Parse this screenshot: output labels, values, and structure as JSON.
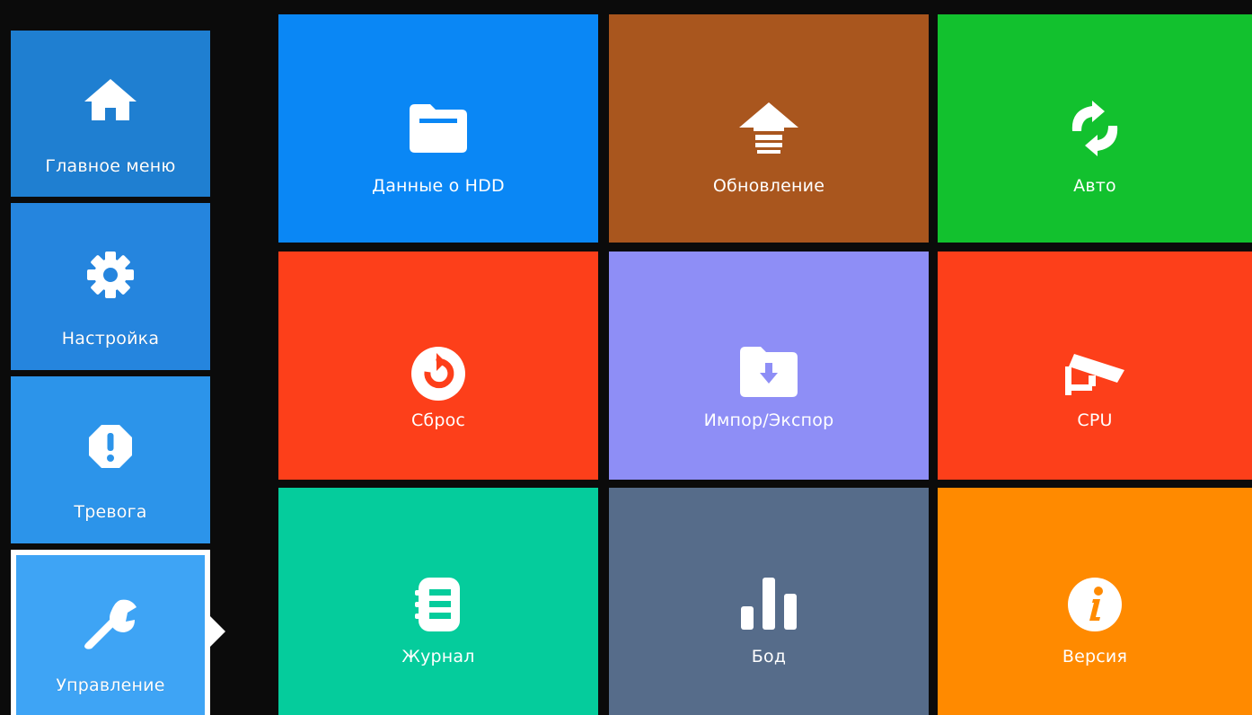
{
  "sidebar": {
    "items": [
      {
        "label": "Главное меню",
        "icon": "home-icon",
        "color": "#1f7fd1"
      },
      {
        "label": "Настройка",
        "icon": "gear-icon",
        "color": "#2585de"
      },
      {
        "label": "Тревога",
        "icon": "alert-icon",
        "color": "#2c94ea"
      },
      {
        "label": "Управление",
        "icon": "wrench-icon",
        "color": "#3ea4f5",
        "active": true
      }
    ]
  },
  "tiles": [
    {
      "label": "Данные о HDD",
      "icon": "folder-icon",
      "color": "#0a87f5"
    },
    {
      "label": "Обновление",
      "icon": "upgrade-arrow-icon",
      "color": "#a9561e"
    },
    {
      "label": "Авто",
      "icon": "refresh-icon",
      "color": "#12c12e"
    },
    {
      "label": "Сброс",
      "icon": "reset-icon",
      "color": "#fd3f1a"
    },
    {
      "label": "Импор/Экспор",
      "icon": "folder-download-icon",
      "color": "#8e8ef6"
    },
    {
      "label": "CPU",
      "icon": "camera-icon",
      "color": "#fd3f1a"
    },
    {
      "label": "Журнал",
      "icon": "log-book-icon",
      "color": "#05cc9c"
    },
    {
      "label": "Бод",
      "icon": "bar-chart-icon",
      "color": "#566c8a"
    },
    {
      "label": "Версия",
      "icon": "info-icon",
      "color": "#ff8a00"
    }
  ]
}
